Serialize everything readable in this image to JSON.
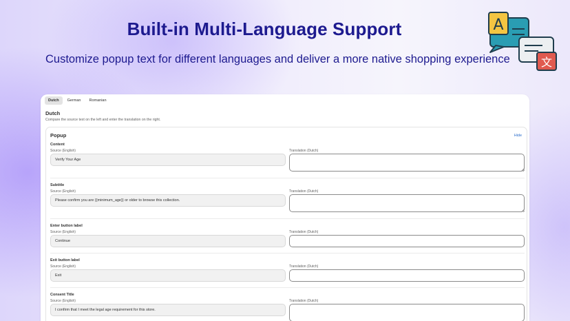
{
  "hero": {
    "title": "Built-in Multi-Language Support",
    "subtitle": "Customize popup text for different languages and deliver a more native shopping experience"
  },
  "icons": {
    "translate": "translate-chat-bubbles-icon",
    "resize": "resize-handle-icon"
  },
  "tabs": [
    {
      "label": "Dutch",
      "active": true
    },
    {
      "label": "German",
      "active": false
    },
    {
      "label": "Romanian",
      "active": false
    }
  ],
  "language": {
    "title": "Dutch",
    "description": "Compare the source text on the left and enter the translation on the right."
  },
  "panel": {
    "title": "Popup",
    "hide_label": "Hide",
    "fields": [
      {
        "label": "Content",
        "source_label": "Source (English)",
        "source_value": "Verify Your Age",
        "translation_label": "Translation (Dutch)",
        "translation_value": ""
      },
      {
        "label": "Subtitle",
        "source_label": "Source (English)",
        "source_value": "Please confirm you are {{minimum_age}} or older to browse this collection.",
        "translation_label": "Translation (Dutch)",
        "translation_value": ""
      },
      {
        "label": "Enter button label",
        "source_label": "Source (English)",
        "source_value": "Continue",
        "translation_label": "Translation (Dutch)",
        "translation_value": ""
      },
      {
        "label": "Exit button label",
        "source_label": "Source (English)",
        "source_value": "Exit",
        "translation_label": "Translation (Dutch)",
        "translation_value": ""
      },
      {
        "label": "Consent Title",
        "source_label": "Source (English)",
        "source_value": "I confirm that I meet the legal age requirement for this store.",
        "translation_label": "Translation (Dutch)",
        "translation_value": ""
      }
    ]
  },
  "colors": {
    "headline": "#1d1a8f",
    "link": "#2c6ecb",
    "bubble_teal": "#2a9db3",
    "bubble_grey": "#eceff1",
    "bubble_red": "#e05a4f"
  }
}
